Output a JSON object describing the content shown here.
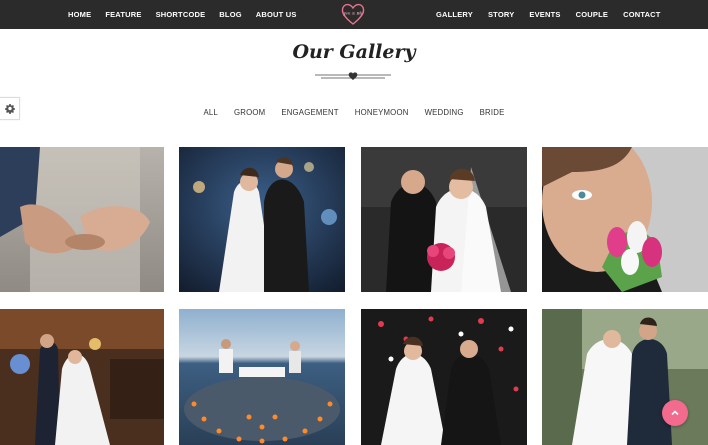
{
  "nav": {
    "left": [
      "HOME",
      "FEATURE",
      "SHORTCODE",
      "BLOG",
      "ABOUT US"
    ],
    "right": [
      "GALLERY",
      "STORY",
      "EVENTS",
      "COUPLE",
      "CONTACT"
    ],
    "logo_text": "Jen & Bb",
    "logo_icon": "heart-logo-icon"
  },
  "gallery": {
    "title": "Our Gallery",
    "filters": [
      "ALL",
      "GROOM",
      "ENGAGEMENT",
      "HONEYMOON",
      "WEDDING",
      "BRIDE"
    ]
  },
  "icons": {
    "settings": "gear-icon",
    "back_to_top": "chevron-up-icon"
  },
  "colors": {
    "nav_bg": "#2b2b2b",
    "accent": "#f26a8d",
    "logo_stroke": "#e8738f"
  }
}
